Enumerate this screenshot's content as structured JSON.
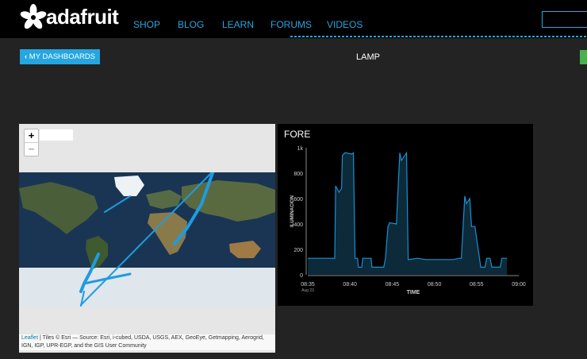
{
  "brand": {
    "name": "adafruit"
  },
  "nav": {
    "items": [
      "SHOP",
      "BLOG",
      "LEARN",
      "FORUMS",
      "VIDEOS"
    ]
  },
  "toolbar": {
    "back_label": "MY DASHBOARDS",
    "back_icon": "chevron-left-icon"
  },
  "page": {
    "title": "LAMP"
  },
  "colors": {
    "accent": "#25a6e1",
    "background": "#232323",
    "line": "#1a6f95",
    "track": "#1e9ce0"
  },
  "map": {
    "zoom_in": "+",
    "zoom_out": "−",
    "attribution_link": "Leaflet",
    "attribution_text": "| Tiles © Esri — Source: Esri, i-cubed, USDA, USGS, AEX, GeoEye, Getmapping, Aerogrid, IGN, IGP, UPR-EGP, and the GIS User Community"
  },
  "chart": {
    "title": "FORE"
  },
  "chart_data": {
    "type": "line",
    "title": "FORE",
    "xlabel": "TIME",
    "ylabel": "ILUMINACION",
    "x_ticks": [
      "08:35",
      "08:40",
      "08:45",
      "08:50",
      "08:55",
      "09:00"
    ],
    "x_sublabel": "Aug 23",
    "y_ticks": [
      "0",
      "200",
      "400",
      "600",
      "800",
      "1k"
    ],
    "ylim": [
      0,
      1000
    ],
    "x_minutes_from": "08:35",
    "series": [
      {
        "x": [
          0,
          3.2,
          3.3,
          3.7,
          4.0,
          4.1,
          4.4,
          4.5,
          5.2,
          5.4,
          5.6,
          5.9,
          6.0,
          6.4,
          6.5,
          7.5,
          7.6,
          8.0,
          8.5,
          9.0,
          9.2,
          9.5,
          9.7,
          10.5,
          10.9,
          11.1,
          11.7,
          11.9,
          13.0,
          14.0,
          16.0,
          17.0,
          17.2,
          18.0,
          18.2,
          18.6,
          18.8,
          19.2,
          19.4,
          19.8,
          20.5,
          21.0,
          21.2,
          21.6,
          21.8,
          22.8,
          23.0,
          23.3,
          23.6
        ],
        "y": [
          130,
          130,
          700,
          650,
          680,
          940,
          960,
          960,
          950,
          960,
          130,
          130,
          60,
          60,
          130,
          130,
          60,
          60,
          60,
          60,
          130,
          380,
          410,
          400,
          960,
          900,
          960,
          120,
          130,
          120,
          120,
          120,
          120,
          130,
          130,
          620,
          560,
          600,
          380,
          380,
          60,
          60,
          130,
          130,
          60,
          60,
          130,
          130,
          130
        ]
      }
    ]
  }
}
